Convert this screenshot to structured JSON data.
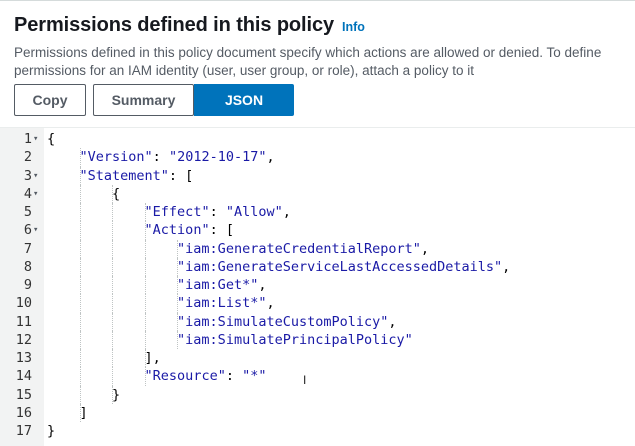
{
  "header": {
    "title": "Permissions defined in this policy",
    "info_label": "Info",
    "description": "Permissions defined in this policy document specify which actions are allowed or denied. To define permissions for an IAM identity (user, user group, or role), attach a policy to it"
  },
  "buttons": {
    "copy": "Copy",
    "summary": "Summary",
    "json": "JSON",
    "selected": "JSON"
  },
  "editor": {
    "lines": [
      {
        "n": "1",
        "fold": true,
        "text": "{"
      },
      {
        "n": "2",
        "fold": false,
        "text": "    \"Version\": \"2012-10-17\","
      },
      {
        "n": "3",
        "fold": true,
        "text": "    \"Statement\": ["
      },
      {
        "n": "4",
        "fold": true,
        "text": "        {"
      },
      {
        "n": "5",
        "fold": false,
        "text": "            \"Effect\": \"Allow\","
      },
      {
        "n": "6",
        "fold": true,
        "text": "            \"Action\": ["
      },
      {
        "n": "7",
        "fold": false,
        "text": "                \"iam:GenerateCredentialReport\","
      },
      {
        "n": "8",
        "fold": false,
        "text": "                \"iam:GenerateServiceLastAccessedDetails\","
      },
      {
        "n": "9",
        "fold": false,
        "text": "                \"iam:Get*\","
      },
      {
        "n": "10",
        "fold": false,
        "text": "                \"iam:List*\","
      },
      {
        "n": "11",
        "fold": false,
        "text": "                \"iam:SimulateCustomPolicy\","
      },
      {
        "n": "12",
        "fold": false,
        "text": "                \"iam:SimulatePrincipalPolicy\""
      },
      {
        "n": "13",
        "fold": false,
        "text": "            ],"
      },
      {
        "n": "14",
        "fold": false,
        "text": "            \"Resource\": \"*\""
      },
      {
        "n": "15",
        "fold": false,
        "text": "        }"
      },
      {
        "n": "16",
        "fold": false,
        "text": "    ]"
      },
      {
        "n": "17",
        "fold": false,
        "text": "}"
      }
    ],
    "fold_icon": "caret-down-icon",
    "string_color": "#1a1aa6"
  },
  "colors": {
    "accent": "#0073bb",
    "gutter_bg": "#f2f3f3"
  }
}
